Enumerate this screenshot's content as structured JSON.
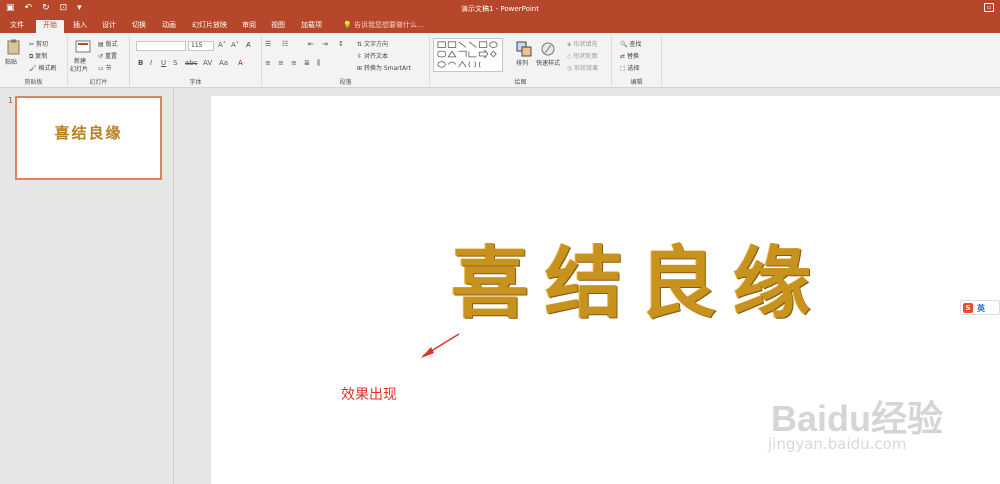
{
  "window": {
    "title": "演示文稿1 - PowerPoint"
  },
  "tabs": [
    {
      "label": "文件"
    },
    {
      "label": "开始"
    },
    {
      "label": "插入"
    },
    {
      "label": "设计"
    },
    {
      "label": "切换"
    },
    {
      "label": "动画"
    },
    {
      "label": "幻灯片放映"
    },
    {
      "label": "审阅"
    },
    {
      "label": "视图"
    },
    {
      "label": "加载项"
    }
  ],
  "tell_me": "告诉我您想要做什么...",
  "ribbon": {
    "clipboard": {
      "paste": "粘贴",
      "cut": "剪切",
      "copy": "复制",
      "format_painter": "格式刷",
      "label": "剪贴板"
    },
    "slides": {
      "new_slide": "新建",
      "new_slide2": "幻灯片",
      "layout": "版式",
      "reset": "重置",
      "section": "节",
      "label": "幻灯片"
    },
    "font": {
      "size": "115",
      "label": "字体"
    },
    "paragraph": {
      "text_direction": "文字方向",
      "align_text": "对齐文本",
      "smartart": "转换为 SmartArt",
      "label": "段落"
    },
    "drawing": {
      "arrange": "排列",
      "quick_styles": "快速样式",
      "shape_fill": "形状填充",
      "shape_outline": "形状轮廓",
      "shape_effects": "形状效果",
      "label": "绘图"
    },
    "editing": {
      "find": "查找",
      "replace": "替换",
      "select": "选择",
      "label": "编辑"
    }
  },
  "slides_pane": {
    "slide_number": "1",
    "thumb_text": "喜结良缘"
  },
  "slide": {
    "title": "喜结良缘",
    "annotation": "效果出现"
  },
  "ime": {
    "logo": "S",
    "lang": "英"
  },
  "watermark": {
    "brand": "Baidu经验",
    "url": "jingyan.baidu.com"
  }
}
